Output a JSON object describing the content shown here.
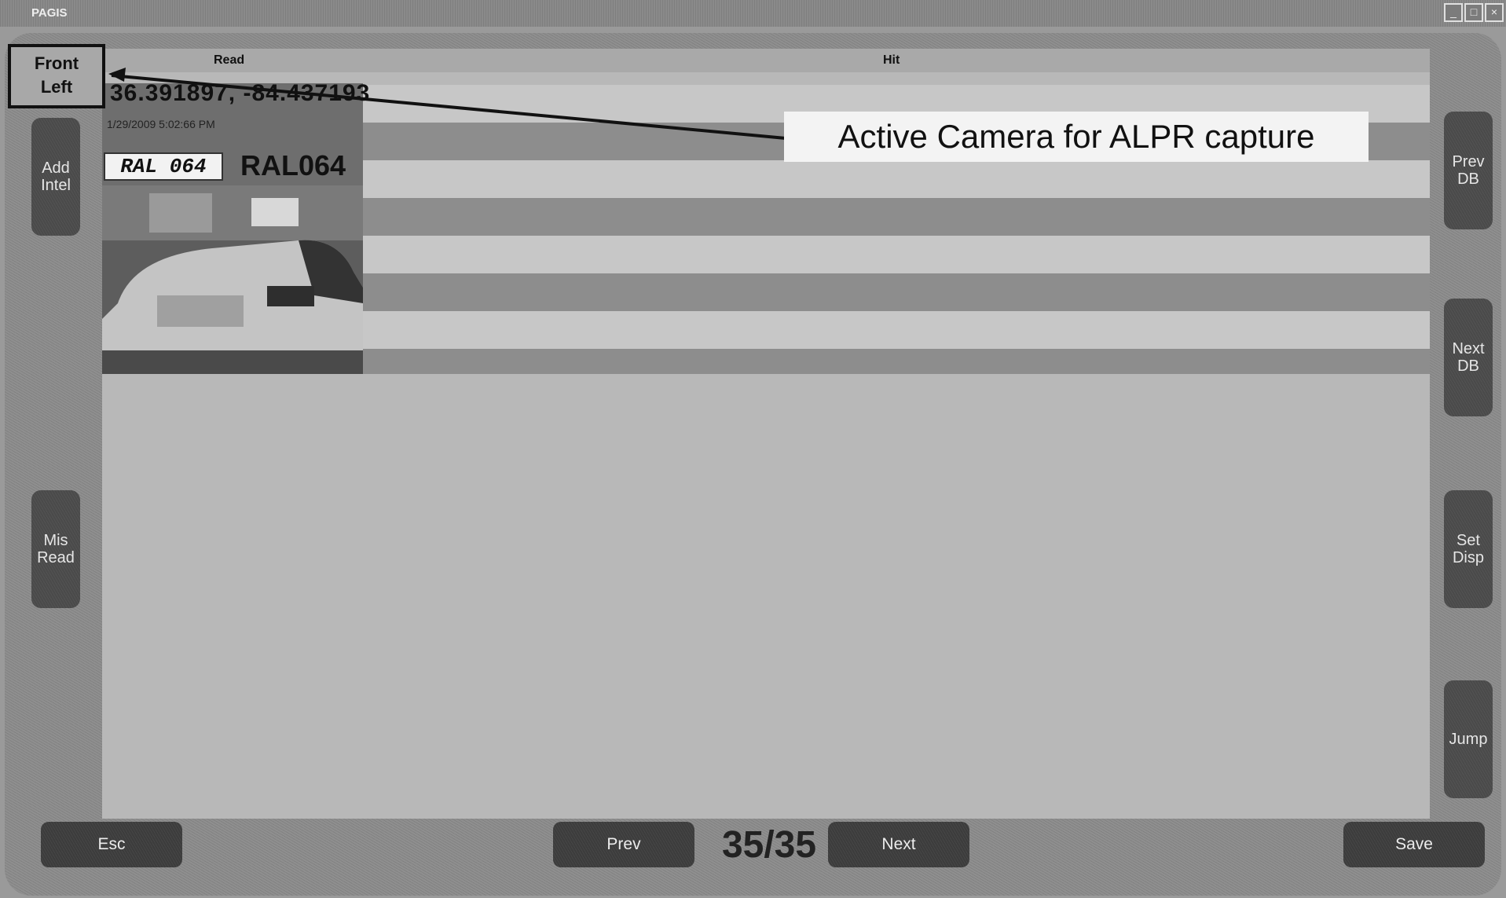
{
  "window": {
    "title": "PAGIS",
    "minimize_glyph": "_",
    "maximize_glyph": "□",
    "close_glyph": "×"
  },
  "camera": {
    "label": "Front\nLeft"
  },
  "header": {
    "read_label": "Read",
    "hit_label": "Hit"
  },
  "record": {
    "coordinates": "36.391897, -84.437193",
    "timestamp": "1/29/2009 5:02:66 PM",
    "plate_crop_text": "RAL 064",
    "plate_read": "RAL064"
  },
  "left_buttons": {
    "add_intel": "Add\nIntel",
    "mis_read": "Mis\nRead"
  },
  "right_buttons": {
    "prev_db": "Prev\nDB",
    "next_db": "Next\nDB",
    "set_disp": "Set\nDisp",
    "jump": "Jump"
  },
  "bottom_bar": {
    "esc": "Esc",
    "prev": "Prev",
    "counter": "35/35",
    "next": "Next",
    "save": "Save"
  },
  "annotation": {
    "text": "Active Camera for ALPR capture"
  }
}
